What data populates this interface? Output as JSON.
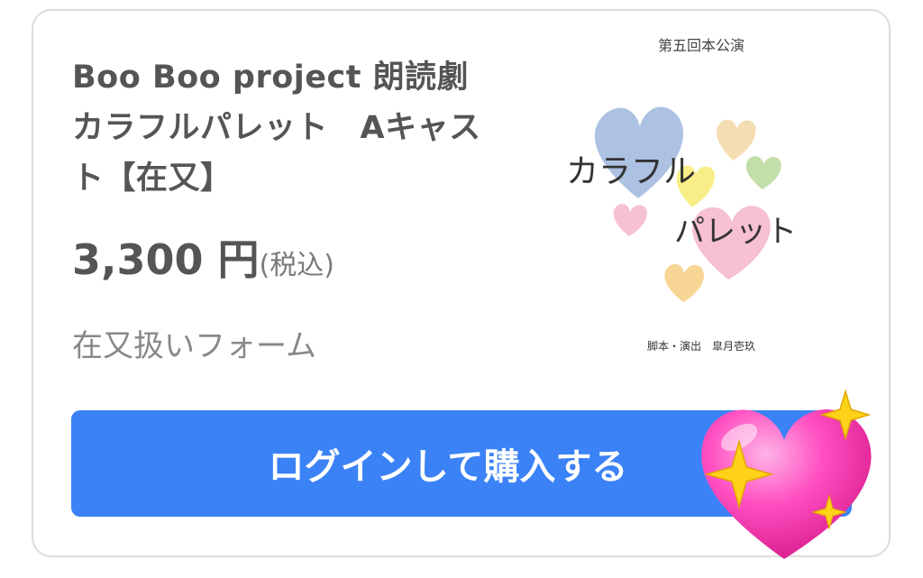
{
  "product": {
    "title": "Boo Boo project 朗読劇 カラフルパレット　Aキャスト【在又】",
    "price": "3,300 円",
    "tax_note": "(税込)",
    "form_name": "在又扱いフォーム"
  },
  "thumbnail": {
    "top_text": "第五回本公演",
    "title_line1": "カラフル",
    "title_line2": "パレット",
    "credit": "脚本・演出　皐月壱玖"
  },
  "button": {
    "label": "ログインして購入する"
  },
  "overlay": {
    "icon": "sparkling-heart-icon"
  },
  "colors": {
    "button": "#3b82f6",
    "text": "#555555",
    "muted": "#888888"
  }
}
